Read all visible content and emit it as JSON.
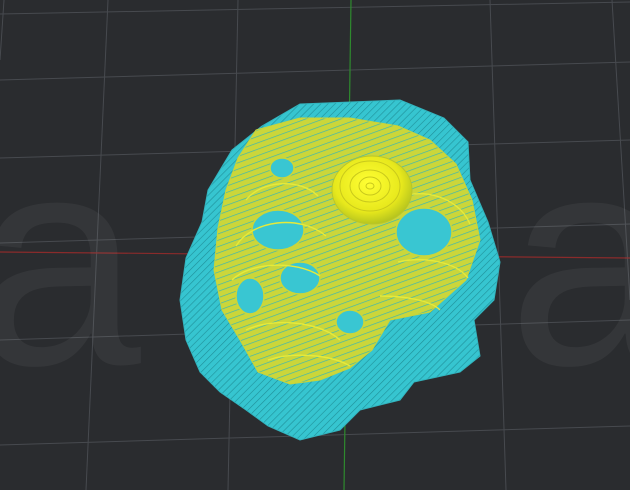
{
  "viewport": {
    "background": "#2a2c2f",
    "grid_color": "#4a4c50",
    "axis_x_color": "#8a2b2b",
    "axis_y_color": "#2e7a2e"
  },
  "watermark": {
    "left_glyph": "a",
    "right_glyph": "a",
    "color": "rgba(255,255,255,0.05)"
  },
  "model": {
    "support_color": "#36c5d0",
    "perimeter_color": "#d8e044",
    "top_color": "#f2f21a"
  }
}
